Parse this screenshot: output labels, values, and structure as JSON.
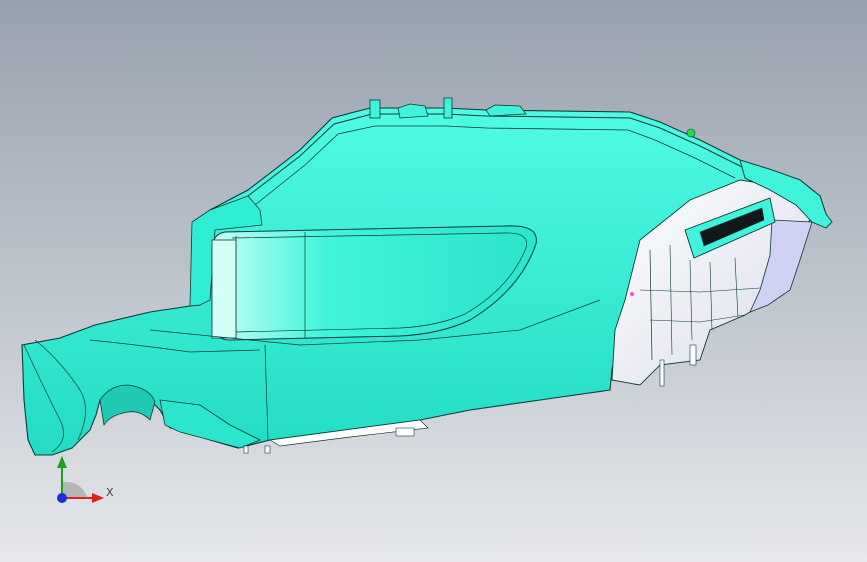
{
  "viewport": {
    "background_top": "#98a2ae",
    "background_bottom": "#e6e8eb"
  },
  "model": {
    "body_color": "#35f2d8",
    "body_shade": "#22d9c0",
    "edge_color": "#0b3a36",
    "interior_color": "#ffffff",
    "interior_shade": "#d9dbe6",
    "highlight_color": "#b8fff4",
    "marker_color": "#22dd44"
  },
  "triad": {
    "x_label": "X",
    "x_color": "#e0201a",
    "y_color": "#1ea01e",
    "z_color": "#1a2ee0",
    "x_icon": "x-axis-arrow-icon",
    "y_icon": "y-axis-arrow-icon",
    "z_icon": "z-axis-origin-icon"
  }
}
